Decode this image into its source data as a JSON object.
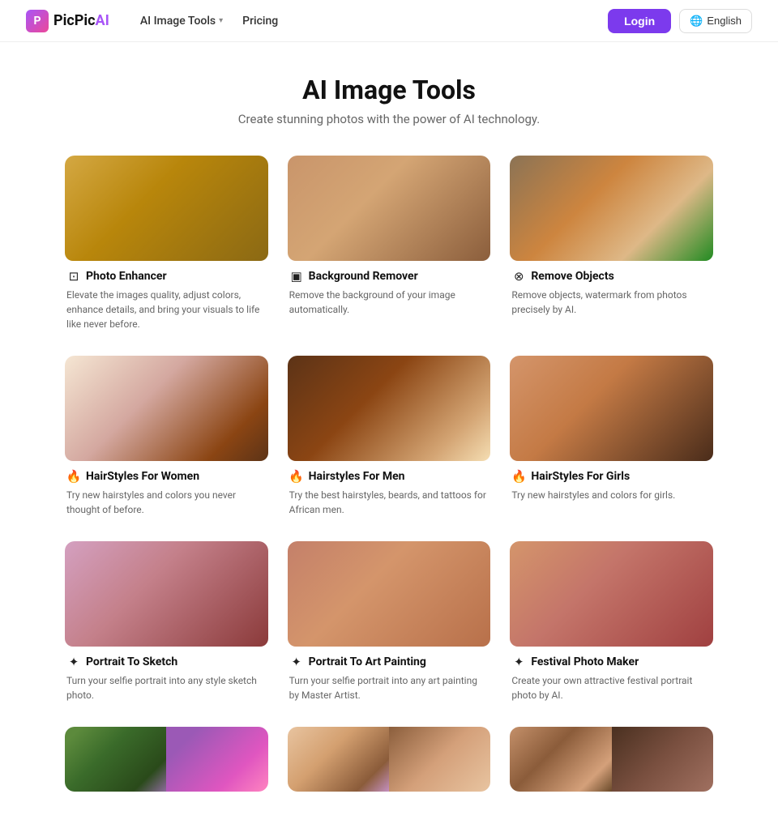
{
  "header": {
    "logo_text": "PicPicAI",
    "logo_icon": "P",
    "nav_items": [
      {
        "label": "AI Image Tools",
        "has_dropdown": true
      },
      {
        "label": "Pricing",
        "has_dropdown": false
      }
    ],
    "login_label": "Login",
    "lang_label": "English"
  },
  "main": {
    "title": "AI Image Tools",
    "subtitle": "Create stunning photos with the power of AI technology.",
    "tools": [
      {
        "id": "photo-enhancer",
        "icon": "⊡",
        "title": "Photo Enhancer",
        "desc": "Elevate the images quality, adjust colors, enhance details, and bring your visuals to life like never before.",
        "img_left": "fox-before",
        "img_right": "fox-after"
      },
      {
        "id": "background-remover",
        "icon": "▣",
        "title": "Background Remover",
        "desc": "Remove the background of your image automatically.",
        "img_left": "person-before",
        "img_right": "person-after"
      },
      {
        "id": "remove-objects",
        "icon": "⊗",
        "title": "Remove Objects",
        "desc": "Remove objects, watermark from photos precisely by AI.",
        "img_left": "dog-before",
        "img_right": "dog-after"
      },
      {
        "id": "hairstyles-women",
        "icon": "🔥",
        "title": "HairStyles For Women",
        "desc": "Try new hairstyles and colors you never thought of before.",
        "img_left": "woman1",
        "img_right": "woman2"
      },
      {
        "id": "hairstyles-men",
        "icon": "🔥",
        "title": "Hairstyles For Men",
        "desc": "Try the best hairstyles, beards, and tattoos for African men.",
        "img_left": "man1",
        "img_right": "man2"
      },
      {
        "id": "hairstyles-girls",
        "icon": "🔥",
        "title": "HairStyles For Girls",
        "desc": "Try new hairstyles and colors for girls.",
        "img_left": "girl1",
        "img_right": "girl2"
      },
      {
        "id": "portrait-sketch",
        "icon": "✦",
        "title": "Portrait To Sketch",
        "desc": "Turn your selfie portrait into any style sketch photo.",
        "img_left": "portrait-photo",
        "img_right": "portrait-sketch"
      },
      {
        "id": "portrait-art",
        "icon": "✦",
        "title": "Portrait To Art Painting",
        "desc": "Turn your selfie portrait into any art painting by Master Artist.",
        "img_left": "art-photo",
        "img_right": "art-painting"
      },
      {
        "id": "festival-maker",
        "icon": "✦",
        "title": "Festival Photo Maker",
        "desc": "Create your own attractive festival portrait photo by AI.",
        "img_left": "festival1",
        "img_right": "festival2"
      }
    ],
    "bottom_row": [
      {
        "id": "bottom1",
        "img_left": "bottom1a",
        "img_right": "bottom1b"
      },
      {
        "id": "bottom2",
        "img_left": "bottom2a",
        "img_right": "bottom2b"
      },
      {
        "id": "bottom3",
        "img_left": "bottom3a",
        "img_right": "bottom3b"
      }
    ]
  }
}
